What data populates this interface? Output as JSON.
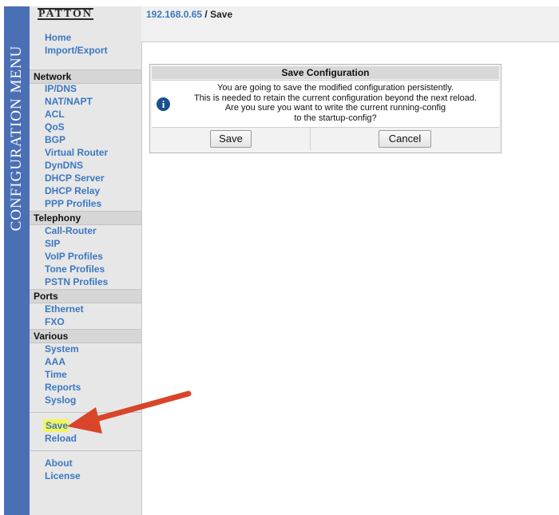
{
  "brand": {
    "logo_text": "PATTON",
    "menu_title": "CONFIGURATION MENU"
  },
  "breadcrumb": {
    "host": "192.168.0.65",
    "separator": " / ",
    "current": "Save"
  },
  "sidebar": {
    "top_links": [
      "Home",
      "Import/Export"
    ],
    "sections": [
      {
        "title": "Network",
        "items": [
          "IP/DNS",
          "NAT/NAPT",
          "ACL",
          "QoS",
          "BGP",
          "Virtual Router",
          "DynDNS",
          "DHCP Server",
          "DHCP Relay",
          "PPP Profiles"
        ]
      },
      {
        "title": "Telephony",
        "items": [
          "Call-Router",
          "SIP",
          "VoIP Profiles",
          "Tone Profiles",
          "PSTN Profiles"
        ]
      },
      {
        "title": "Ports",
        "items": [
          "Ethernet",
          "FXO"
        ]
      },
      {
        "title": "Various",
        "items": [
          "System",
          "AAA",
          "Time",
          "Reports",
          "Syslog"
        ]
      }
    ],
    "actions": [
      "Save",
      "Reload"
    ],
    "footer": [
      "About",
      "License"
    ]
  },
  "dialog": {
    "title": "Save Configuration",
    "message_lines": [
      "You are going to save the modified configuration persistently.",
      "This is needed to retain the current configuration beyond the next reload.",
      "Are you sure you want to write the current running-config",
      "to the startup-config?"
    ],
    "save_label": "Save",
    "cancel_label": "Cancel"
  },
  "colors": {
    "band": "#4a6fb5",
    "link": "#3b78c2",
    "highlight": "#f4f55d",
    "arrow": "#d8452a",
    "info_icon": "#1a4f8f"
  },
  "icons": {
    "info": "info-icon",
    "pointer": "red-arrow"
  }
}
